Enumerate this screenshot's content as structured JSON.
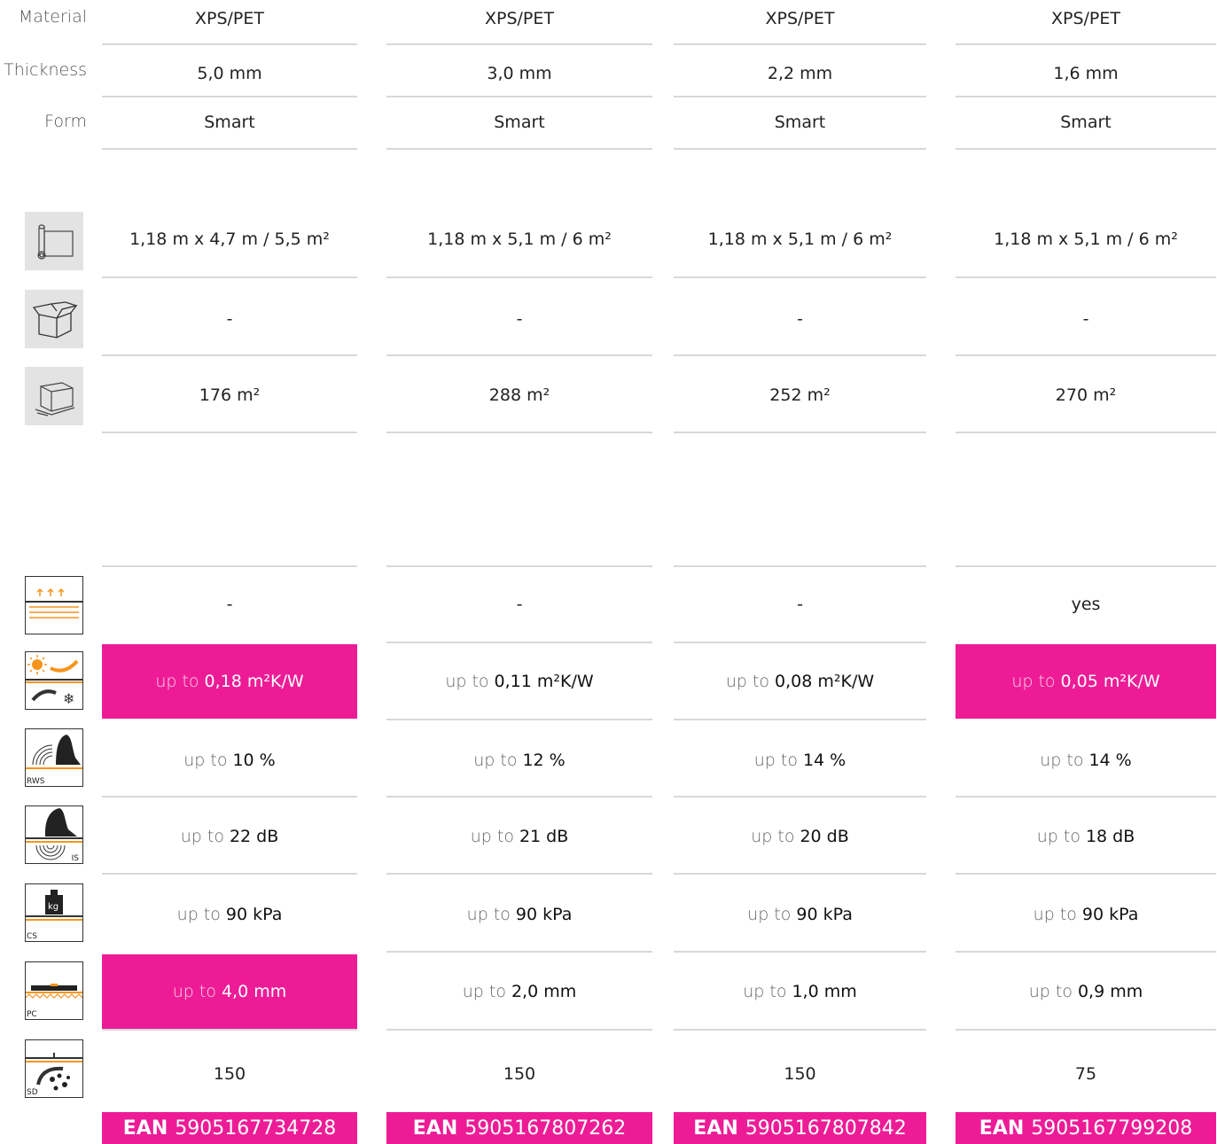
{
  "row_labels": {
    "material": "Material",
    "thickness": "Thickness",
    "form": "Form"
  },
  "icons": {
    "roll": "roll-dimensions-icon",
    "open_box": "open-box-icon",
    "pallet": "pallet-icon",
    "heating": "underfloor-heating-icon",
    "thermal": "thermal-resistance-icon",
    "rws": "walking-sound-icon",
    "is": "impact-sound-icon",
    "cs": "compressive-strength-icon",
    "pc": "point-compensation-icon",
    "sd": "vapour-barrier-icon"
  },
  "icon_tags": {
    "rws": "RWS",
    "is": "IS",
    "cs": "CS",
    "pc": "PC",
    "sd": "SD",
    "kg": "kg"
  },
  "prefix": "up to",
  "ean_label": "EAN",
  "colors": {
    "accent": "#ed1c96",
    "divider": "#d8d8d8",
    "icon_bg": "#e3e3e3",
    "orange": "#f7941d"
  },
  "products": [
    {
      "material": "XPS/PET",
      "thickness": "5,0 mm",
      "form": "Smart",
      "roll": "1,18 m x 4,7 m / 5,5 m²",
      "box": "-",
      "pallet": "176 m²",
      "heating": "-",
      "thermal": "0,18 m²K/W",
      "rws": "10 %",
      "is": "22  dB",
      "cs": "90  kPa",
      "pc": "4,0 mm",
      "sd": "150",
      "ean": "5905167734728",
      "highlight_thermal": true,
      "highlight_pc": true
    },
    {
      "material": "XPS/PET",
      "thickness": "3,0 mm",
      "form": "Smart",
      "roll": "1,18 m x 5,1 m / 6 m²",
      "box": "-",
      "pallet": "288 m²",
      "heating": "-",
      "thermal": "0,11 m²K/W",
      "rws": "12 %",
      "is": "21 dB",
      "cs": "90  kPa",
      "pc": "2,0 mm",
      "sd": "150",
      "ean": "5905167807262",
      "highlight_thermal": false,
      "highlight_pc": false
    },
    {
      "material": "XPS/PET",
      "thickness": "2,2 mm",
      "form": "Smart",
      "roll": "1,18 m x 5,1 m / 6 m²",
      "box": "-",
      "pallet": "252 m²",
      "heating": "-",
      "thermal": "0,08 m²K/W",
      "rws": "14 %",
      "is": "20 dB",
      "cs": "90  kPa",
      "pc": "1,0 mm",
      "sd": "150",
      "ean": "5905167807842",
      "highlight_thermal": false,
      "highlight_pc": false
    },
    {
      "material": "XPS/PET",
      "thickness": "1,6 mm",
      "form": "Smart",
      "roll": "1,18 m x 5,1 m / 6 m²",
      "box": "-",
      "pallet": "270 m²",
      "heating": "yes",
      "thermal": "0,05 m²K/W",
      "rws": "14 %",
      "is": "18 dB",
      "cs": "90  kPa",
      "pc": "0,9 mm",
      "sd": "75",
      "ean": "5905167799208",
      "highlight_thermal": true,
      "highlight_pc": false
    }
  ]
}
